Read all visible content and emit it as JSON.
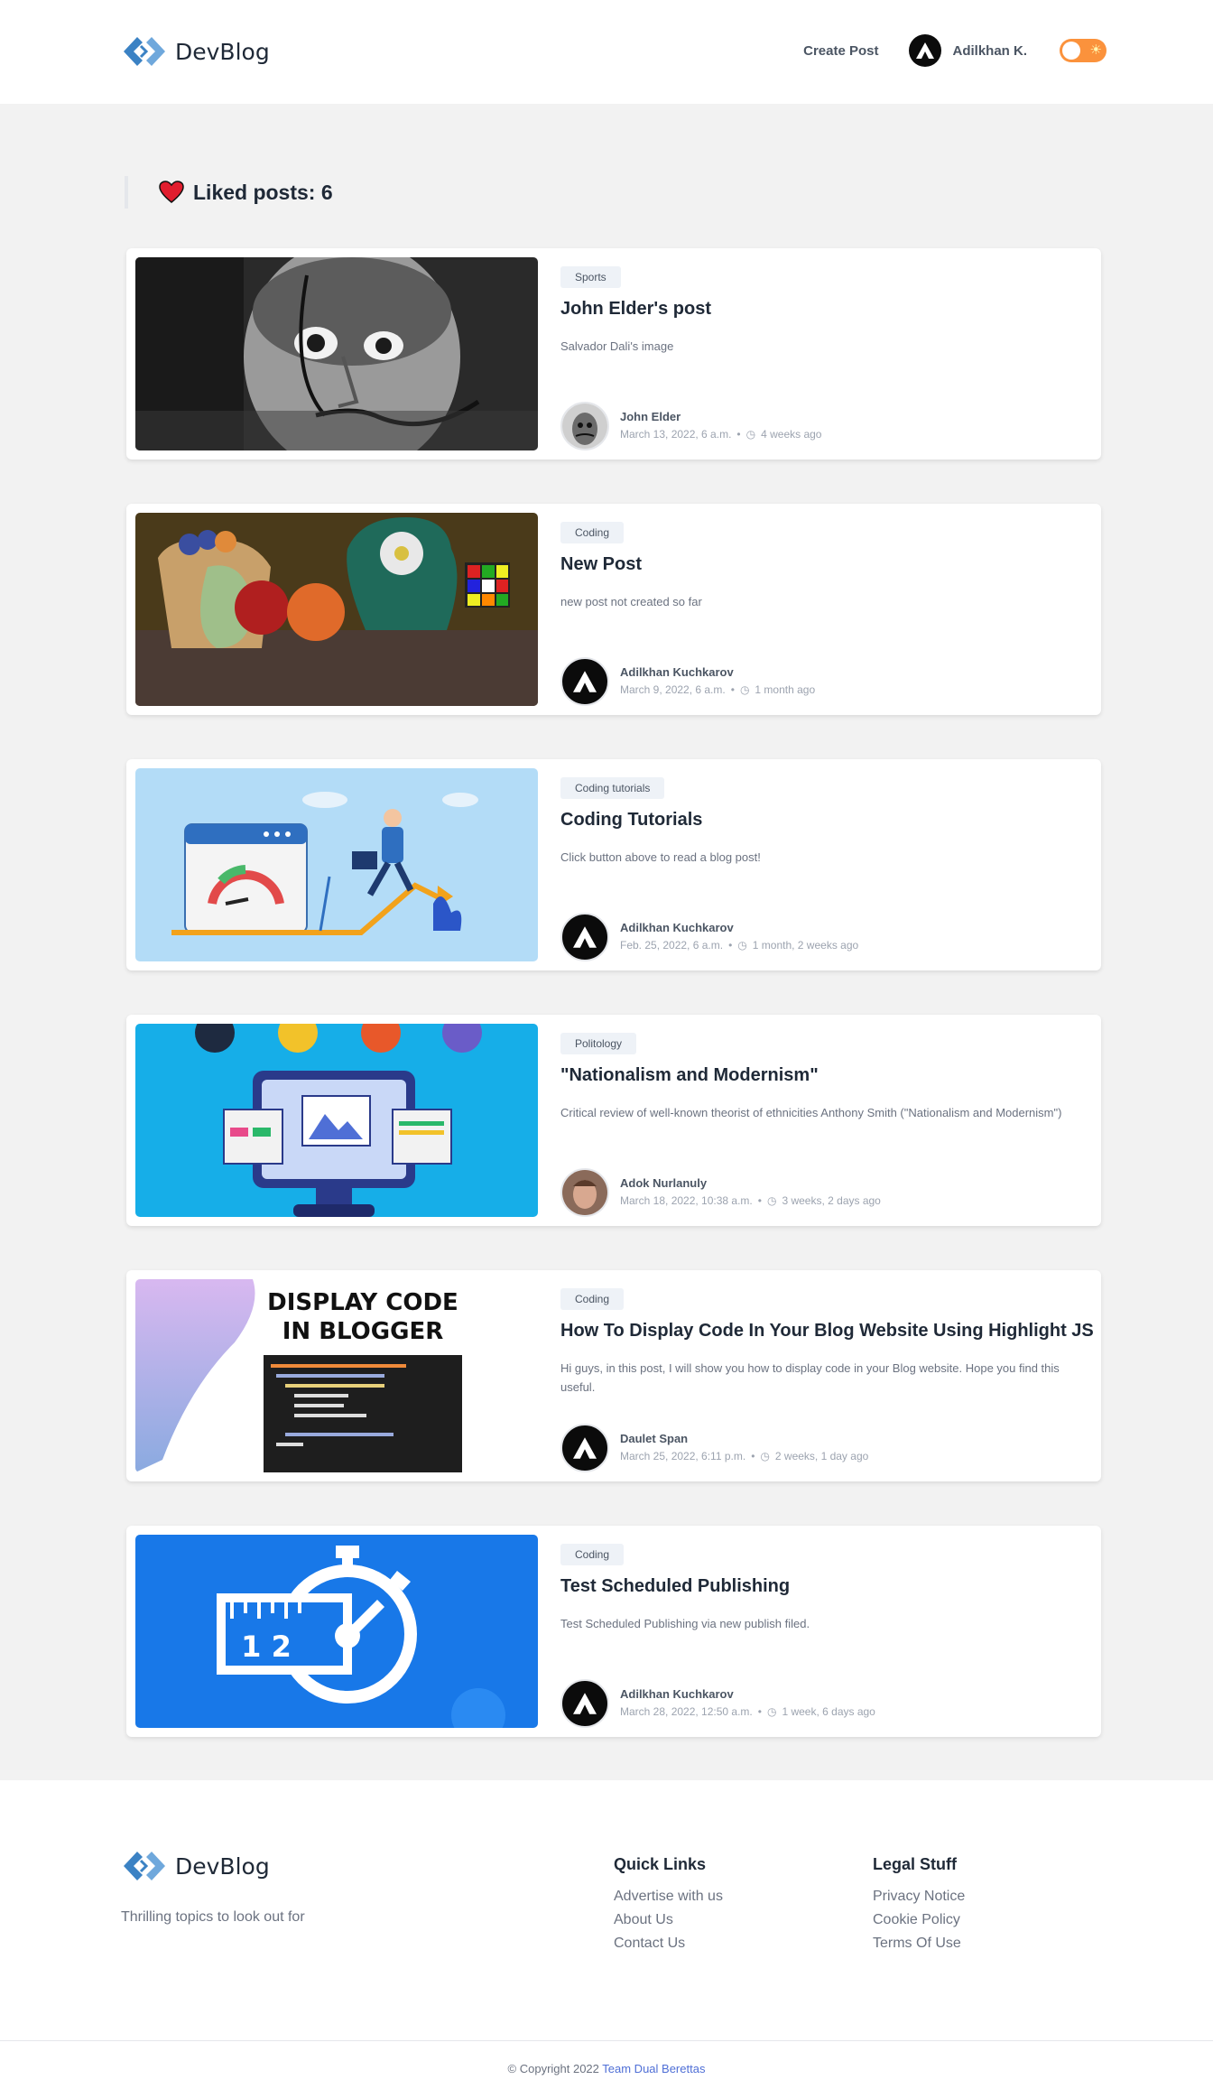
{
  "header": {
    "brand": "DevBlog",
    "create_post": "Create Post",
    "user_name": "Adilkhan K."
  },
  "liked": {
    "title": "Liked posts: 6"
  },
  "posts": [
    {
      "tag": "Sports",
      "title": "John Elder's post",
      "description": "Salvador Dali's image",
      "author": "John Elder",
      "date": "March 13, 2022, 6 a.m.",
      "ago": "4 weeks ago"
    },
    {
      "tag": "Coding",
      "title": "New Post",
      "description": "new post not created so far",
      "author": "Adilkhan Kuchkarov",
      "date": "March 9, 2022, 6 a.m.",
      "ago": "1 month ago"
    },
    {
      "tag": "Coding tutorials",
      "title": "Coding Tutorials",
      "description": "Click button above to read a blog post!",
      "author": "Adilkhan Kuchkarov",
      "date": "Feb. 25, 2022, 6 a.m.",
      "ago": "1 month, 2 weeks ago"
    },
    {
      "tag": "Politology",
      "title": "\"Nationalism and Modernism\"",
      "description": "Critical review of well-known theorist of ethnicities Anthony Smith (\"Nationalism and Modernism\")",
      "author": "Adok Nurlanuly",
      "date": "March 18, 2022, 10:38 a.m.",
      "ago": "3 weeks, 2 days ago"
    },
    {
      "tag": "Coding",
      "title": "How To Display Code In Your Blog Website Using Highlight JS",
      "description": "Hi guys, in this post, I will show you how to display code in your Blog website. Hope you find this useful.",
      "author": "Daulet Span",
      "date": "March 25, 2022, 6:11 p.m.",
      "ago": "2 weeks, 1 day ago"
    },
    {
      "tag": "Coding",
      "title": "Test Scheduled Publishing",
      "description": "Test Scheduled Publishing via new publish filed.",
      "author": "Adilkhan Kuchkarov",
      "date": "March 28, 2022, 12:50 a.m.",
      "ago": "1 week, 6 days ago"
    }
  ],
  "thumb_text": {
    "display_code_line1": "DISPLAY CODE",
    "display_code_line2": "IN BLOGGER",
    "ruler_digits": "1 2"
  },
  "footer": {
    "brand": "DevBlog",
    "tagline": "Thrilling topics to look out for",
    "quick_links_title": "Quick Links",
    "quick_links": [
      "Advertise with us",
      "About Us",
      "Contact Us"
    ],
    "legal_title": "Legal Stuff",
    "legal_links": [
      "Privacy Notice",
      "Cookie Policy",
      "Terms Of Use"
    ],
    "copyright": "© Copyright 2022",
    "team": "Team Dual Berettas"
  },
  "colors": {
    "accent_toggle": "#fb923c",
    "logo_blue": "#3b82c4",
    "heart": "#e11d2e",
    "link_team": "#4f6fd6"
  }
}
